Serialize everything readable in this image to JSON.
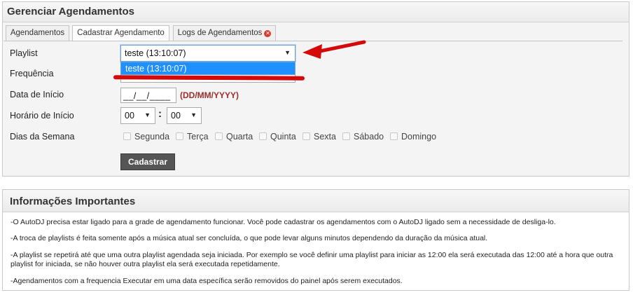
{
  "panel_title": "Gerenciar Agendamentos",
  "tabs": [
    {
      "label": "Agendamentos",
      "active": false
    },
    {
      "label": "Cadastrar Agendamento",
      "active": true
    },
    {
      "label": "Logs de Agendamentos",
      "active": false,
      "icon": "close-circle-icon"
    }
  ],
  "form": {
    "playlist_label": "Playlist",
    "playlist_value": "teste (13:10:07)",
    "playlist_dropdown_options": [
      "teste (13:10:07)"
    ],
    "frequencia_label": "Frequência",
    "data_inicio_label": "Data de Início",
    "data_inicio_value": "__/__/____",
    "data_inicio_hint": "(DD/MM/YYYY)",
    "horario_label": "Horário de Início",
    "hora_value": "00",
    "minuto_value": "00",
    "dias_label": "Dias da Semana",
    "dias": [
      "Segunda",
      "Terça",
      "Quarta",
      "Quinta",
      "Sexta",
      "Sábado",
      "Domingo"
    ],
    "submit_label": "Cadastrar"
  },
  "annotations": {
    "arrow_color": "#d40a0a",
    "underline_color": "#d40a0a"
  },
  "info_panel": {
    "title": "Informações Importantes",
    "lines": [
      "-O AutoDJ precisa estar ligado para a grade de agendamento funcionar. Você pode cadastrar os agendamentos com o AutoDJ ligado sem a necessidade de desliga-lo.",
      "-A troca de playlists é feita somente após a música atual ser concluída, o que pode levar alguns minutos dependendo da duração da música atual.",
      "-A playlist se repetirá até que uma outra playlist agendada seja iniciada. Por exemplo se você definir uma playlist para iniciar as 12:00 ela será executada das 12:00 até a hora que outra playlist for iniciada, se não houver outra playlist ela será executada repetidamente.",
      "-Agendamentos com a frequencia Executar em uma data específica serão removidos do painel após serem executados."
    ]
  }
}
